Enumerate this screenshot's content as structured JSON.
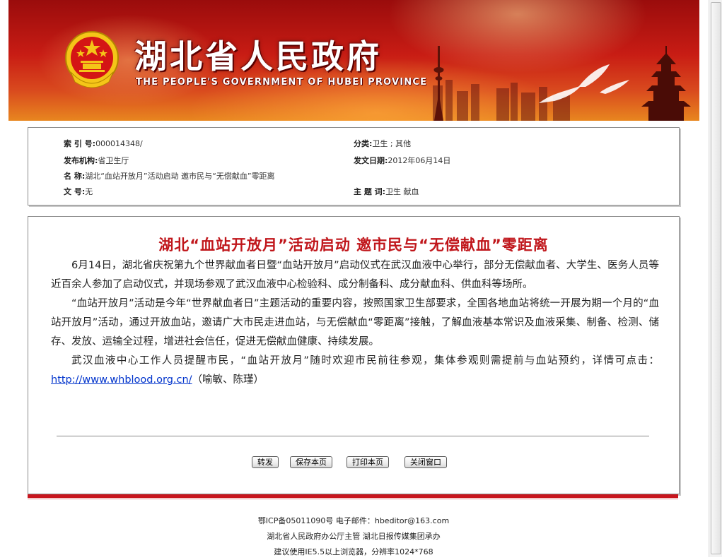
{
  "header": {
    "title_cn": "湖北省人民政府",
    "title_en": "THE PEOPLE'S GOVERNMENT OF HUBEI PROVINCE",
    "colors": {
      "banner_dark": "#9a0c0c",
      "banner_light": "#e8861f",
      "emblem_gold": "#f5c518"
    }
  },
  "info": {
    "index_label": "索  引  号:",
    "index_value": "000014348/",
    "category_label": "分类:",
    "category_value": "卫生 ; 其他",
    "publisher_label": "发布机构:",
    "publisher_value": "省卫生厅",
    "date_label": "发文日期:",
    "date_value": "2012年06月14日",
    "name_label": "名        称:",
    "name_value": "湖北“血站开放月”活动启动 邀市民与“无偿献血”零距离",
    "docno_label": "文        号:",
    "docno_value": "无",
    "keywords_label": "主  题  词:",
    "keywords_value": "卫生 献血"
  },
  "article": {
    "title": "湖北“血站开放月”活动启动 邀市民与“无偿献血”零距离",
    "title_color": "#c0161b",
    "paragraphs": [
      "6月14日，湖北省庆祝第九个世界献血者日暨“血站开放月”启动仪式在武汉血液中心举行，部分无偿献血者、大学生、医务人员等近百余人参加了启动仪式，并现场参观了武汉血液中心检验科、成分制备科、成分献血科、供血科等场所。",
      "“血站开放月”活动是今年“世界献血者日”主题活动的重要内容，按照国家卫生部要求，全国各地血站将统一开展为期一个月的“血站开放月”活动，通过开放血站，邀请广大市民走进血站，与无偿献血“零距离”接触，了解血液基本常识及血液采集、制备、检测、储存、发放、运输全过程，增进社会信任，促进无偿献血健康、持续发展。"
    ],
    "p3_text": "武汉血液中心工作人员提醒市民，“血站开放月”随时欢迎市民前往参观，集体参观则需提前与血站预约，详情可点击：",
    "p3_link": "http://www.whblood.org.cn/",
    "p3_suffix": "（喻敏、陈瑾）"
  },
  "buttons": {
    "forward": "转发",
    "save": "保存本页",
    "print": "打印本页",
    "close": "关闭窗口"
  },
  "footer": {
    "line1": "鄂ICP备05011090号 电子邮件：hbeditor@163.com",
    "line2": "湖北省人民政府办公厅主管 湖北日报传媒集团承办",
    "line3": "建议使用IE5.5以上浏览器，分辨率1024*768",
    "rule_color": "#c8161e"
  }
}
